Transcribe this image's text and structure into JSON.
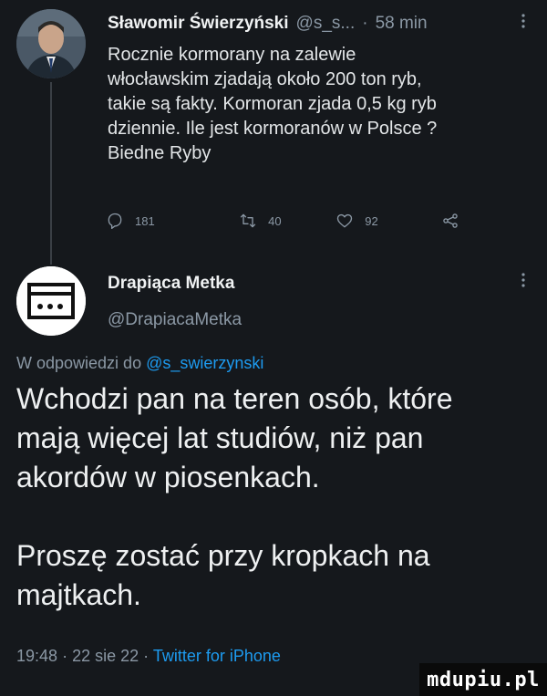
{
  "tweet": {
    "author_name": "Sławomir Świerzyński",
    "author_handle": "@s_s...",
    "separator": "·",
    "time": "58 min",
    "more_icon": "more-vertical-icon",
    "text": "Rocznie kormorany na zalewie\nwłocławskim zjadają około 200 ton ryb,\ntakie są fakty. Kormoran zjada 0,5 kg ryb\ndziennie.  Ile jest kormoranów w Polsce ?\nBiedne Ryby",
    "actions": {
      "reply_count": "181",
      "retweet_count": "40",
      "like_count": "92"
    }
  },
  "reply": {
    "author_name": "Drapiąca Metka",
    "author_handle": "@DrapiacaMetka",
    "context_prefix": "W odpowiedzi do ",
    "context_mention": "@s_swierzynski",
    "text": "Wchodzi pan na teren osób, które\nmają więcej lat studiów, niż pan\nakordów w piosenkach.\n\nProszę zostać przy kropkach na\nmajtkach.",
    "time": "19:48",
    "date": "22 sie 22",
    "separator": "·",
    "client": "Twitter for iPhone"
  },
  "watermark": "mdupiu.pl",
  "colors": {
    "background": "#15181c",
    "link": "#1d9bf0",
    "muted": "#8b98a5"
  }
}
